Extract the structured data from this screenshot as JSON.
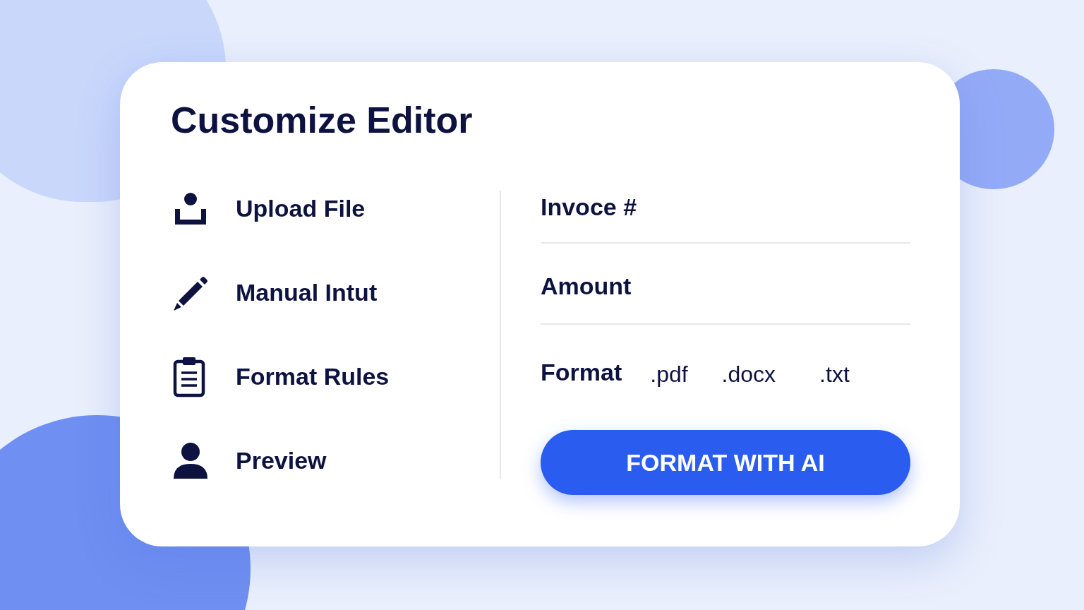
{
  "title": "Customize Editor",
  "menu": [
    {
      "kind": "upload",
      "label": "Upload File"
    },
    {
      "kind": "pencil",
      "label": "Manual Intut"
    },
    {
      "kind": "clipboard",
      "label": "Format Rules"
    },
    {
      "kind": "person",
      "label": "Preview"
    }
  ],
  "fields": [
    {
      "placeholder": "Invoce #"
    },
    {
      "placeholder": "Amount"
    }
  ],
  "format": {
    "label": "Format",
    "options": [
      {
        "label": ".pdf",
        "selected": false
      },
      {
        "label": ".docx",
        "selected": false
      },
      {
        "label": ".txt",
        "selected": false
      }
    ]
  },
  "button": "FORMAT WITH AI"
}
